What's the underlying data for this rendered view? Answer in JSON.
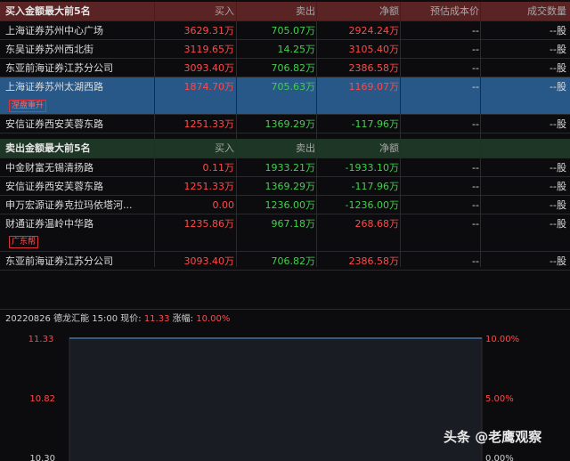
{
  "buy_section": {
    "title": "买入金额最大前5名",
    "headers": {
      "buy": "买入",
      "sell": "卖出",
      "net": "净额",
      "cost": "预估成本价",
      "avg": "成交数量"
    },
    "rows": [
      {
        "name": "上海证券苏州中心广场",
        "buy": "3629.31万",
        "sell": "705.07万",
        "net": "2924.24万",
        "cost": "--",
        "avg": "--股",
        "badge": ""
      },
      {
        "name": "东吴证券苏州西北街",
        "buy": "3119.65万",
        "sell": "14.25万",
        "net": "3105.40万",
        "cost": "--",
        "avg": "--股",
        "badge": ""
      },
      {
        "name": "东亚前海证券江苏分公司",
        "buy": "3093.40万",
        "sell": "706.82万",
        "net": "2386.58万",
        "cost": "--",
        "avg": "--股",
        "badge": ""
      },
      {
        "name": "上海证券苏州太湖西路",
        "buy": "1874.70万",
        "sell": "705.63万",
        "net": "1169.07万",
        "cost": "--",
        "avg": "--股",
        "badge": "涅盘重升"
      },
      {
        "name": "安信证券西安芙蓉东路",
        "buy": "1251.33万",
        "sell": "1369.29万",
        "net": "-117.96万",
        "cost": "--",
        "avg": "--股",
        "badge": ""
      }
    ]
  },
  "sell_section": {
    "title": "卖出金额最大前5名",
    "headers": {
      "buy": "买入",
      "sell": "卖出",
      "net": "净额",
      "cost": "",
      "avg": ""
    },
    "rows": [
      {
        "name": "中金财富无锡清扬路",
        "buy": "0.11万",
        "sell": "1933.21万",
        "net": "-1933.10万",
        "cost": "--",
        "avg": "--股",
        "badge": ""
      },
      {
        "name": "安信证券西安芙蓉东路",
        "buy": "1251.33万",
        "sell": "1369.29万",
        "net": "-117.96万",
        "cost": "--",
        "avg": "--股",
        "badge": ""
      },
      {
        "name": "申万宏源证券克拉玛依塔河...",
        "buy": "0.00",
        "sell": "1236.00万",
        "net": "-1236.00万",
        "cost": "--",
        "avg": "--股",
        "badge": ""
      },
      {
        "name": "财通证券温岭中华路",
        "buy": "1235.86万",
        "sell": "967.18万",
        "net": "268.68万",
        "cost": "--",
        "avg": "--股",
        "badge": "广东帮"
      },
      {
        "name": "东亚前海证券江苏分公司",
        "buy": "3093.40万",
        "sell": "706.82万",
        "net": "2386.58万",
        "cost": "--",
        "avg": "--股",
        "badge": ""
      }
    ]
  },
  "info_bar": {
    "date_label": "20220826 德龙汇能 15:00 现价:",
    "price": "11.33",
    "change_label": "涨幅:",
    "change": "10.00%"
  },
  "chart": {
    "left_ticks": [
      "11.33",
      "10.82",
      "10.30"
    ],
    "right_ticks": [
      "10.00%",
      "5.00%",
      "0.00%"
    ]
  },
  "watermark": "头条 @老鹰观察",
  "colors": {
    "up": "#ff4a4a",
    "down": "#3fd24b",
    "selected": "#285887",
    "buy_header": "#5a2324",
    "sell_header": "#1e3626"
  }
}
